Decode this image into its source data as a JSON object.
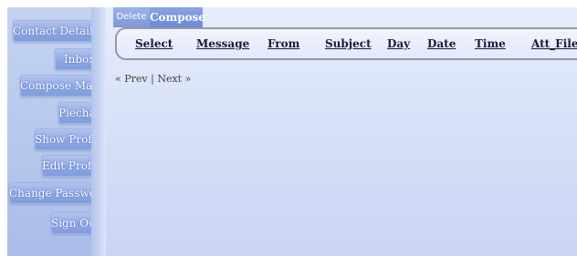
{
  "sidebar": {
    "items": [
      {
        "label": "Contact Details"
      },
      {
        "label": "Inbox"
      },
      {
        "label": "Compose Mail"
      },
      {
        "label": "Piechar"
      },
      {
        "label": "Show Profile"
      },
      {
        "label": "Edit Profile"
      },
      {
        "label": "Change Password"
      },
      {
        "label": "Sign Out"
      }
    ]
  },
  "tabs": {
    "delete_label": "Delete",
    "compose_label": "Compose"
  },
  "table": {
    "columns": [
      "Select",
      "Message",
      "From",
      "Subject",
      "Day",
      "Date",
      "Time",
      "Att_File"
    ]
  },
  "pager": {
    "prev": "« Prev",
    "separator": "|",
    "next": "Next »"
  }
}
